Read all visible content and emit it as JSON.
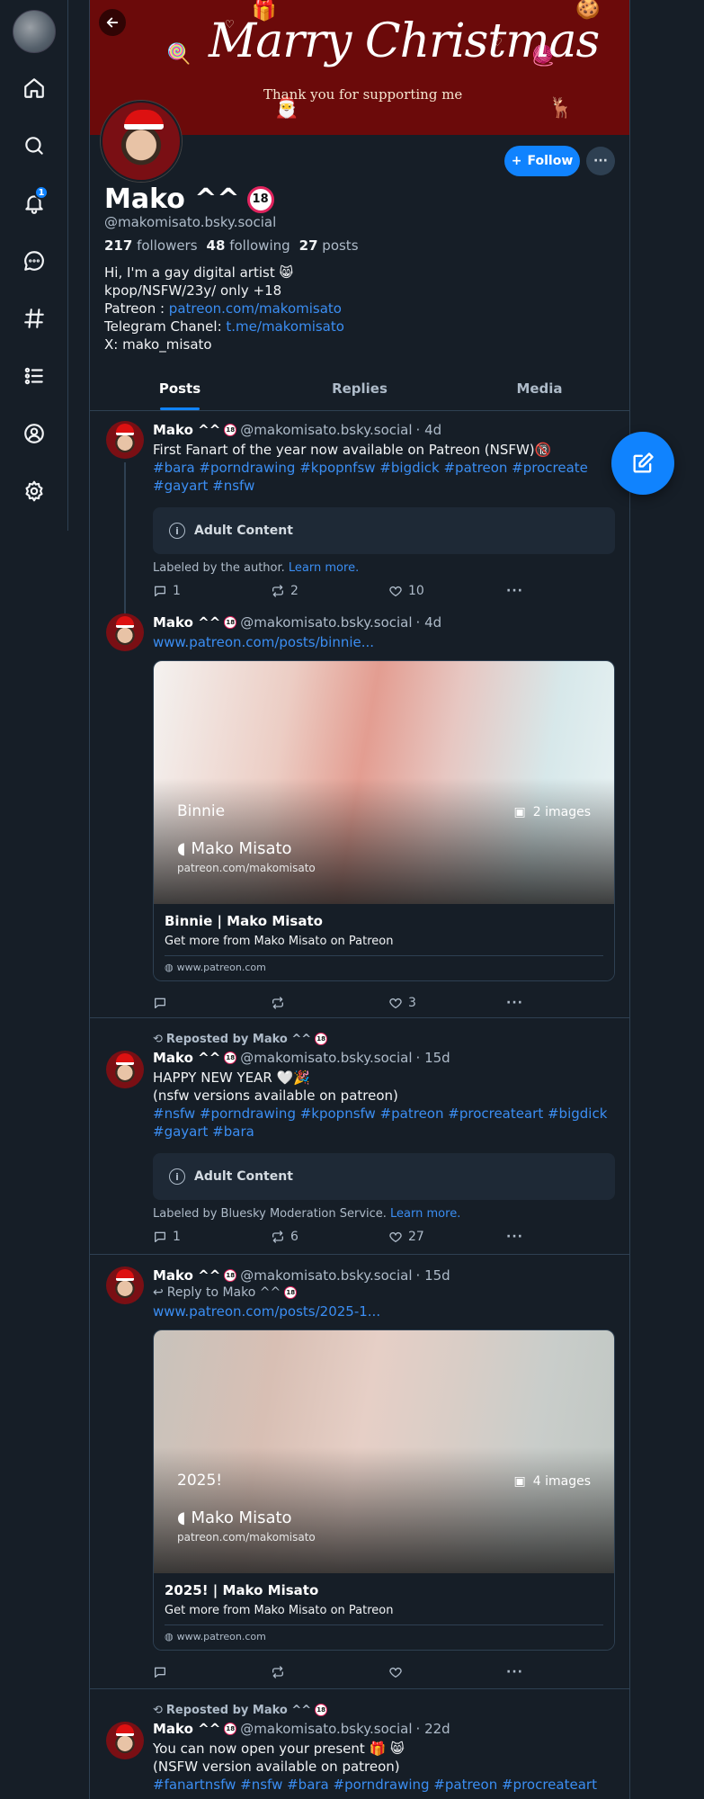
{
  "banner": {
    "title": "Marry Christmas",
    "subtitle": "Thank you for supporting me"
  },
  "profile": {
    "display_name": "Mako ^^",
    "age_badge": "18",
    "handle": "@makomisato.bsky.social",
    "followers_count": "217",
    "followers_label": "followers",
    "following_count": "48",
    "following_label": "following",
    "posts_count": "27",
    "posts_label": "posts",
    "bio": {
      "line1": "Hi, I'm a gay digital artist 😸",
      "line2": "kpop/NSFW/23y/ only +18",
      "line3_prefix": "Patreon : ",
      "line3_link": "patreon.com/makomisato",
      "line4_prefix": "Telegram Chanel: ",
      "line4_link": "t.me/makomisato",
      "line5": "X: mako_misato"
    },
    "follow_label": "Follow",
    "more_label": "···"
  },
  "sidebar": {
    "notification_count": "1"
  },
  "tabs": [
    {
      "label": "Posts"
    },
    {
      "label": "Replies"
    },
    {
      "label": "Media"
    }
  ],
  "posts": [
    {
      "name": "Mako ^^",
      "handle": "@makomisato.bsky.social",
      "time": "· 4d",
      "text": "First Fanart of the year now available on Patreon (NSFW)🔞",
      "tags": "#bara #porndrawing #kpopnfsw #bigdick #patreon #procreate #gayart #nsfw",
      "adult_label": "Adult Content",
      "labeled_text": "Labeled by the author.",
      "learn_more": "Learn more.",
      "replies": "1",
      "reposts": "2",
      "likes": "10"
    },
    {
      "name": "Mako ^^",
      "handle": "@makomisato.bsky.social",
      "time": "· 4d",
      "link": "www.patreon.com/posts/binnie...",
      "card": {
        "image_title": "Binnie",
        "image_count": "2 images",
        "image_author": "Mako Misato",
        "image_url": "patreon.com/makomisato",
        "title": "Binnie | Mako Misato",
        "desc": "Get more from Mako Misato on Patreon",
        "domain": "www.patreon.com"
      },
      "replies": "",
      "reposts": "",
      "likes": "3"
    },
    {
      "repost_label": "Reposted by Mako ^^",
      "name": "Mako ^^",
      "handle": "@makomisato.bsky.social",
      "time": "· 15d",
      "text_line1": "HAPPY NEW YEAR 🤍🎉",
      "text_line2": "(nsfw versions available on patreon)",
      "tags": "#nsfw #porndrawing #kpopnsfw #patreon #procreateart #bigdick #gayart #bara",
      "adult_label": "Adult Content",
      "labeled_text": "Labeled by Bluesky Moderation Service.",
      "learn_more": "Learn more.",
      "replies": "1",
      "reposts": "6",
      "likes": "27"
    },
    {
      "name": "Mako ^^",
      "handle": "@makomisato.bsky.social",
      "time": "· 15d",
      "reply_label": "Reply to Mako ^^",
      "link": "www.patreon.com/posts/2025-1...",
      "card": {
        "image_title": "2025!",
        "image_count": "4 images",
        "image_author": "Mako Misato",
        "image_url": "patreon.com/makomisato",
        "title": "2025! | Mako Misato",
        "desc": "Get more from Mako Misato on Patreon",
        "domain": "www.patreon.com"
      },
      "replies": "",
      "reposts": "",
      "likes": ""
    },
    {
      "repost_label": "Reposted by Mako ^^",
      "name": "Mako ^^",
      "handle": "@makomisato.bsky.social",
      "time": "· 22d",
      "text_line1": "You can now open your present 🎁 😸",
      "text_line2": "(NSFW version available on patreon)",
      "tags": "#fanartnsfw #nsfw #bara #porndrawing #patreon #procreateart"
    }
  ]
}
